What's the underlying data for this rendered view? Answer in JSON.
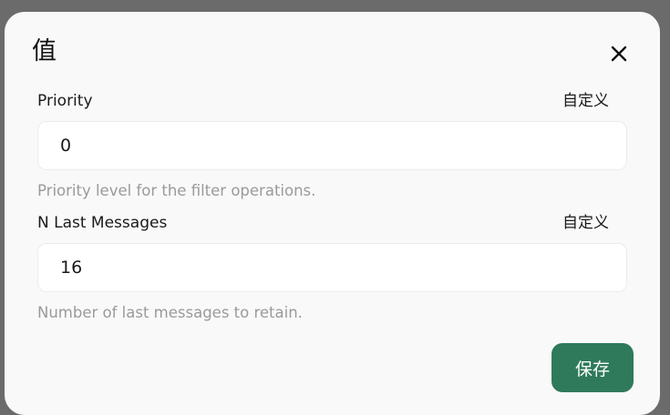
{
  "dialog": {
    "title": "值",
    "close_icon": "close-icon",
    "save_label": "保存",
    "save_color": "#2f7a5b"
  },
  "fields": [
    {
      "label": "Priority",
      "custom_label": "自定义",
      "value": "0",
      "help": "Priority level for the filter operations."
    },
    {
      "label": "N Last Messages",
      "custom_label": "自定义",
      "value": "16",
      "help": "Number of last messages to retain."
    }
  ]
}
